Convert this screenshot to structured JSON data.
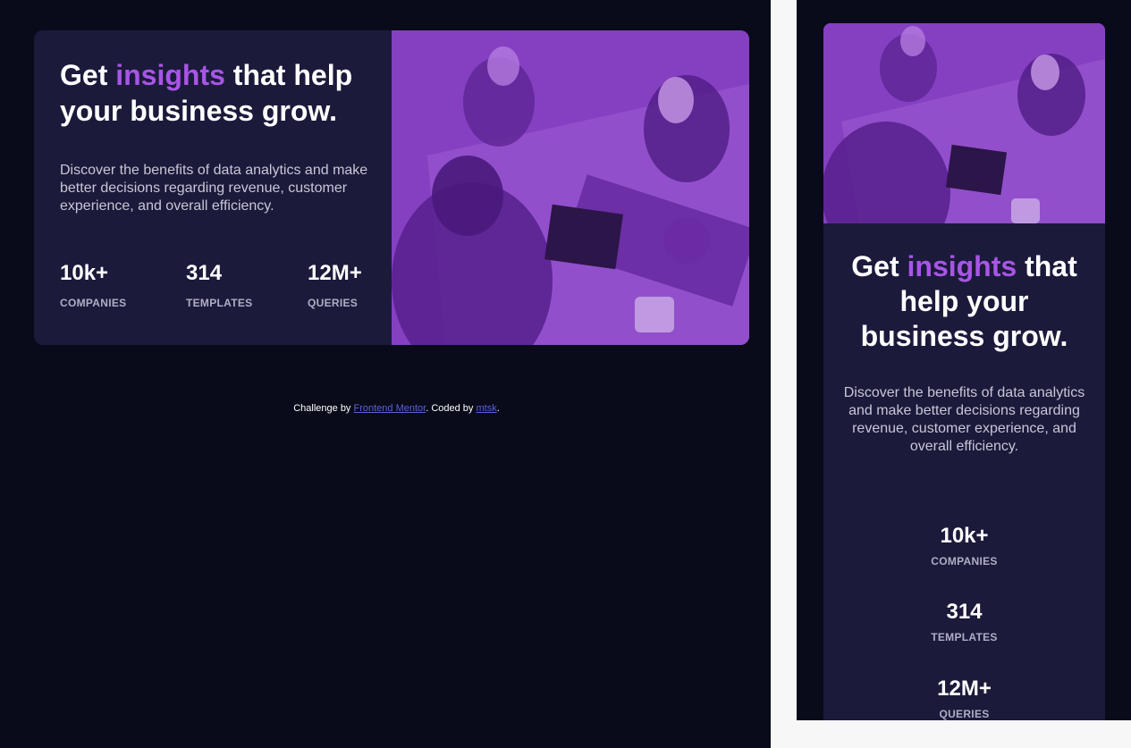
{
  "card": {
    "headline_pre": "Get ",
    "headline_accent": "insights",
    "headline_post": " that help your business grow.",
    "description": "Discover the benefits of data analytics and make better decisions regarding revenue, customer experience, and overall efficiency.",
    "stats": [
      {
        "value": "10k+",
        "label": "COMPANIES"
      },
      {
        "value": "314",
        "label": "TEMPLATES"
      },
      {
        "value": "12M+",
        "label": "QUERIES"
      }
    ]
  },
  "footer": {
    "prefix": "Challenge by ",
    "link1": "Frontend Mentor",
    "middle": ". Coded by ",
    "link2": "mtsk",
    "suffix": "."
  },
  "colors": {
    "background": "#090b1a",
    "card": "#1b1a3b",
    "accent": "#a855e6",
    "image_overlay": "#7a36b8"
  }
}
